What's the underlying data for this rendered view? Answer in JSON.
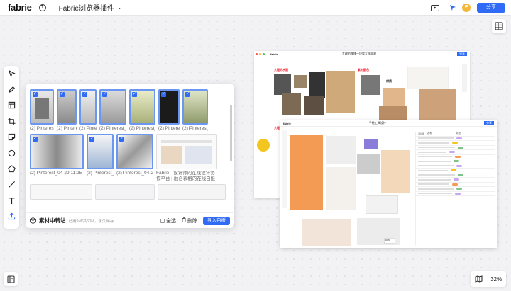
{
  "app": {
    "logo": "fabrie",
    "doc_title": "Fabrie浏览器插件",
    "share_label": "分享",
    "avatar_letter": "F",
    "help_label": "?"
  },
  "canvas": {
    "zoom": "32%"
  },
  "panel": {
    "title": "素材中转站",
    "quota": "已用9M/共50M，永久储存",
    "select_all": "全选",
    "delete": "删除",
    "import": "导入白板",
    "row1": [
      {
        "caption": "(2) Pinterest_04-29 11:25",
        "selected": true
      },
      {
        "caption": "(2) Pinterest_04-29 11:25",
        "selected": true
      },
      {
        "caption": "(2) Pinterest_04-29 11:25",
        "selected": true
      },
      {
        "caption": "(2) Pinterest_04-29 11:25",
        "selected": true
      },
      {
        "caption": "(2) Pinterest_04-29 11:25",
        "selected": true
      },
      {
        "caption": "(2) Pinterest_04-29 11:25",
        "selected": true
      },
      {
        "caption": "(2) Pinterest_04-29 11:25",
        "selected": true
      }
    ],
    "row2": [
      {
        "caption": "(2) Pinterest_04-29 11:25",
        "selected": true
      },
      {
        "caption": "(2) Pinterest_04-29 11:25",
        "selected": true
      },
      {
        "caption": "(2) Pinterest_04-29 11:25",
        "selected": true
      },
      {
        "caption": "Fabrie - 设计师的在线设计协作平台 | 融合表格的在线白板工...",
        "selected": false
      }
    ]
  },
  "board1": {
    "title": "大理的咖啡一块看大理滨湖",
    "tag1": "大理的水面",
    "tag2": "素材配色",
    "tag3": "材质",
    "tag4": "材料质感",
    "tag5": "大理的上"
  },
  "board2": {
    "title": "手绘工具设计",
    "count": "10/36",
    "col_name": "名称",
    "col_status": "状态",
    "zoom": "50%",
    "share": "分享"
  },
  "colors": {
    "accent": "#2f6bf5"
  }
}
